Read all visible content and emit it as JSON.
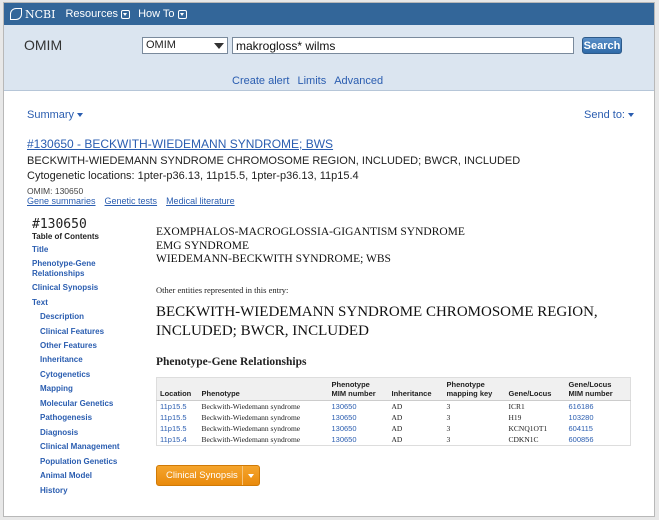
{
  "topnav": {
    "logo": "NCBI",
    "items": [
      "Resources",
      "How To"
    ]
  },
  "search": {
    "db_title": "OMIM",
    "db_select": "OMIM",
    "query": "makrogloss* wilms",
    "button": "Search",
    "links": [
      "Create alert",
      "Limits",
      "Advanced"
    ]
  },
  "toolbar": {
    "summary": "Summary",
    "send_to": "Send to:"
  },
  "result": {
    "title": "#130650 - BECKWITH-WIEDEMANN SYNDROME; BWS",
    "included": "BECKWITH-WIEDEMANN SYNDROME CHROMOSOME REGION, INCLUDED; BWCR, INCLUDED",
    "cytogenetic": "Cytogenetic locations: 1pter-p36.13, 11p15.5, 1pter-p36.13, 11p15.4",
    "omim_id": "OMIM: 130650",
    "links": [
      "Gene summaries",
      "Genetic tests",
      "Medical literature"
    ]
  },
  "toc": {
    "mim": "#130650",
    "heading": "Table of Contents",
    "items": [
      {
        "label": "Title",
        "indent": false
      },
      {
        "label": "Phenotype-Gene",
        "indent": false
      },
      {
        "label": "Relationships",
        "indent": false
      },
      {
        "label": "Clinical Synopsis",
        "indent": false
      },
      {
        "label": "Text",
        "indent": false
      },
      {
        "label": "Description",
        "indent": true
      },
      {
        "label": "Clinical Features",
        "indent": true
      },
      {
        "label": "Other Features",
        "indent": true
      },
      {
        "label": "Inheritance",
        "indent": true
      },
      {
        "label": "Cytogenetics",
        "indent": true
      },
      {
        "label": "Mapping",
        "indent": true
      },
      {
        "label": "Molecular Genetics",
        "indent": true
      },
      {
        "label": "Pathogenesis",
        "indent": true
      },
      {
        "label": "Diagnosis",
        "indent": true
      },
      {
        "label": "Clinical Management",
        "indent": true
      },
      {
        "label": "Population Genetics",
        "indent": true
      },
      {
        "label": "Animal Model",
        "indent": true
      },
      {
        "label": "History",
        "indent": true
      }
    ]
  },
  "main": {
    "alt_names": [
      "EXOMPHALOS-MACROGLOSSIA-GIGANTISM SYNDROME",
      "EMG SYNDROME",
      "WIEDEMANN-BECKWITH SYNDROME; WBS"
    ],
    "other_entities": "Other entities represented in this entry:",
    "big_title": "BECKWITH-WIEDEMANN SYNDROME CHROMOSOME REGION, INCLUDED; BWCR, INCLUDED",
    "pgr_title": "Phenotype-Gene Relationships",
    "table": {
      "headers": [
        "Location",
        "Phenotype",
        "Phenotype MIM number",
        "Inheritance",
        "Phenotype mapping key",
        "Gene/Locus",
        "Gene/Locus MIM number"
      ],
      "rows": [
        [
          "11p15.5",
          "Beckwith-Wiedemann syndrome",
          "130650",
          "AD",
          "3",
          "ICR1",
          "616186"
        ],
        [
          "11p15.5",
          "Beckwith-Wiedemann syndrome",
          "130650",
          "AD",
          "3",
          "H19",
          "103280"
        ],
        [
          "11p15.5",
          "Beckwith-Wiedemann syndrome",
          "130650",
          "AD",
          "3",
          "KCNQ1OT1",
          "604115"
        ],
        [
          "11p15.4",
          "Beckwith-Wiedemann syndrome",
          "130650",
          "AD",
          "3",
          "CDKN1C",
          "600856"
        ]
      ]
    },
    "clinical_synopsis_button": "Clinical Synopsis"
  },
  "colors": {
    "nav": "#336699",
    "search_bg": "#dbe5f0",
    "link": "#2a5db0",
    "orange_button": "#ef9519"
  }
}
